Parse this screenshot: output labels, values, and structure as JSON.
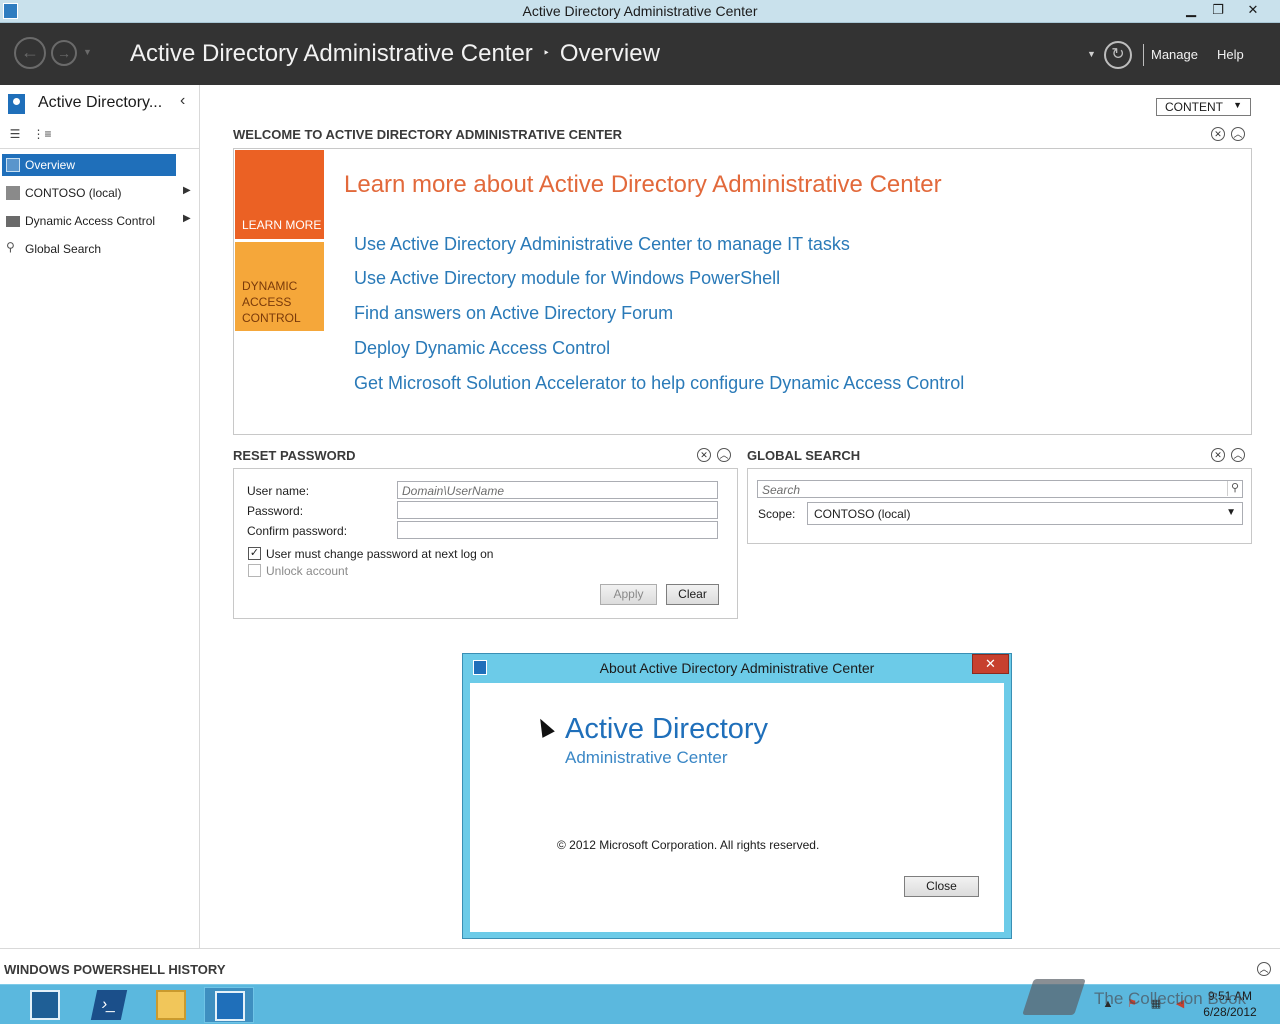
{
  "window": {
    "title": "Active Directory Administrative Center",
    "minimize": "▁",
    "restore": "❐",
    "close": "✕"
  },
  "header": {
    "crumb_root": "Active Directory Administrative Center",
    "crumb_separator": "‣",
    "crumb_current": "Overview",
    "manage_label": "Manage",
    "help_label": "Help"
  },
  "sidebar": {
    "title": "Active Directory...",
    "items": [
      {
        "label": "Overview",
        "icon": "overview-icon",
        "selected": true
      },
      {
        "label": "CONTOSO (local)",
        "icon": "domain-icon",
        "has_children": true
      },
      {
        "label": "Dynamic Access Control",
        "icon": "folder-icon",
        "has_children": true
      },
      {
        "label": "Global Search",
        "icon": "search-icon"
      }
    ]
  },
  "content_button": {
    "label": "CONTENT"
  },
  "welcome": {
    "section_title": "WELCOME TO ACTIVE DIRECTORY ADMINISTRATIVE CENTER",
    "tile_learn_more": "LEARN MORE",
    "tile_dac": "DYNAMIC ACCESS CONTROL",
    "heading": "Learn more about Active Directory Administrative Center",
    "links": [
      "Use Active Directory Administrative Center to manage IT tasks",
      "Use Active Directory module for Windows PowerShell",
      "Find answers on Active Directory Forum",
      "Deploy Dynamic Access Control",
      "Get Microsoft Solution Accelerator to help configure Dynamic Access Control"
    ]
  },
  "reset_password": {
    "section_title": "RESET PASSWORD",
    "user_name_label": "User name:",
    "user_name_placeholder": "Domain\\UserName",
    "password_label": "Password:",
    "confirm_label": "Confirm password:",
    "must_change_label": "User must change password at next log on",
    "must_change_checked": true,
    "unlock_label": "Unlock account",
    "unlock_checked": false,
    "apply_label": "Apply",
    "clear_label": "Clear"
  },
  "global_search": {
    "section_title": "GLOBAL SEARCH",
    "search_placeholder": "Search",
    "scope_label": "Scope:",
    "scope_value": "CONTOSO (local)"
  },
  "about_dialog": {
    "title": "About Active Directory Administrative Center",
    "product": "Active Directory",
    "product_sub": "Administrative Center",
    "copyright": "© 2012 Microsoft Corporation. All rights reserved.",
    "close_label": "Close"
  },
  "powershell_history": {
    "label": "WINDOWS POWERSHELL HISTORY"
  },
  "taskbar": {
    "apps": [
      "server-manager-icon",
      "powershell-icon",
      "file-explorer-icon",
      "ad-admin-center-icon"
    ],
    "time": "9:51 AM",
    "date": "6/28/2012"
  },
  "watermark": {
    "text": "The Collection Book"
  },
  "colors": {
    "header_bg": "#333333",
    "selected_bg": "#1f6fba",
    "accent_orange": "#eb6124",
    "accent_yellow": "#f5a73a",
    "link": "#2a7ab8",
    "dialog_frame": "#6ccbe8",
    "taskbar_bg": "#5bb8de"
  }
}
